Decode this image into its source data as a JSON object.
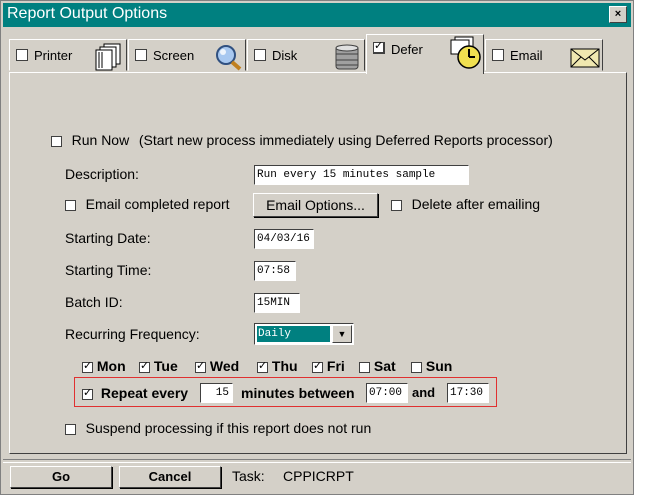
{
  "window": {
    "title": "Report Output Options",
    "close_label": "×"
  },
  "tabs": [
    {
      "label": "Printer",
      "checked": false,
      "icon": "printer-pages-icon"
    },
    {
      "label": "Screen",
      "checked": false,
      "icon": "magnifier-icon"
    },
    {
      "label": "Disk",
      "checked": false,
      "icon": "disk-stack-icon"
    },
    {
      "label": "Defer",
      "checked": true,
      "icon": "clock-pages-icon"
    },
    {
      "label": "Email",
      "checked": false,
      "icon": "envelope-icon"
    }
  ],
  "defer": {
    "run_now_label": "Run Now",
    "run_now_hint": "(Start new process immediately using Deferred Reports processor)",
    "description_label": "Description:",
    "description_value": "Run every 15 minutes sample",
    "email_completed_label": "Email completed report",
    "email_options_button": "Email Options...",
    "delete_after_label": "Delete after emailing",
    "starting_date_label": "Starting Date:",
    "starting_date_value": "04/03/16",
    "starting_time_label": "Starting Time:",
    "starting_time_value": "07:58",
    "batch_id_label": "Batch ID:",
    "batch_id_value": "15MIN",
    "recurring_label": "Recurring Frequency:",
    "recurring_value": "Daily",
    "days": [
      {
        "label": "Mon",
        "checked": true
      },
      {
        "label": "Tue",
        "checked": true
      },
      {
        "label": "Wed",
        "checked": true
      },
      {
        "label": "Thu",
        "checked": true
      },
      {
        "label": "Fri",
        "checked": true
      },
      {
        "label": "Sat",
        "checked": false
      },
      {
        "label": "Sun",
        "checked": false
      }
    ],
    "repeat_label": "Repeat every",
    "repeat_interval": "15",
    "repeat_between_label": "minutes between",
    "repeat_start": "07:00",
    "repeat_and_label": "and",
    "repeat_end": "17:30",
    "suspend_label": "Suspend processing if this report does not run"
  },
  "footer": {
    "go_button": "Go",
    "cancel_button": "Cancel",
    "task_label": "Task:",
    "task_value": "CPPICRPT"
  }
}
